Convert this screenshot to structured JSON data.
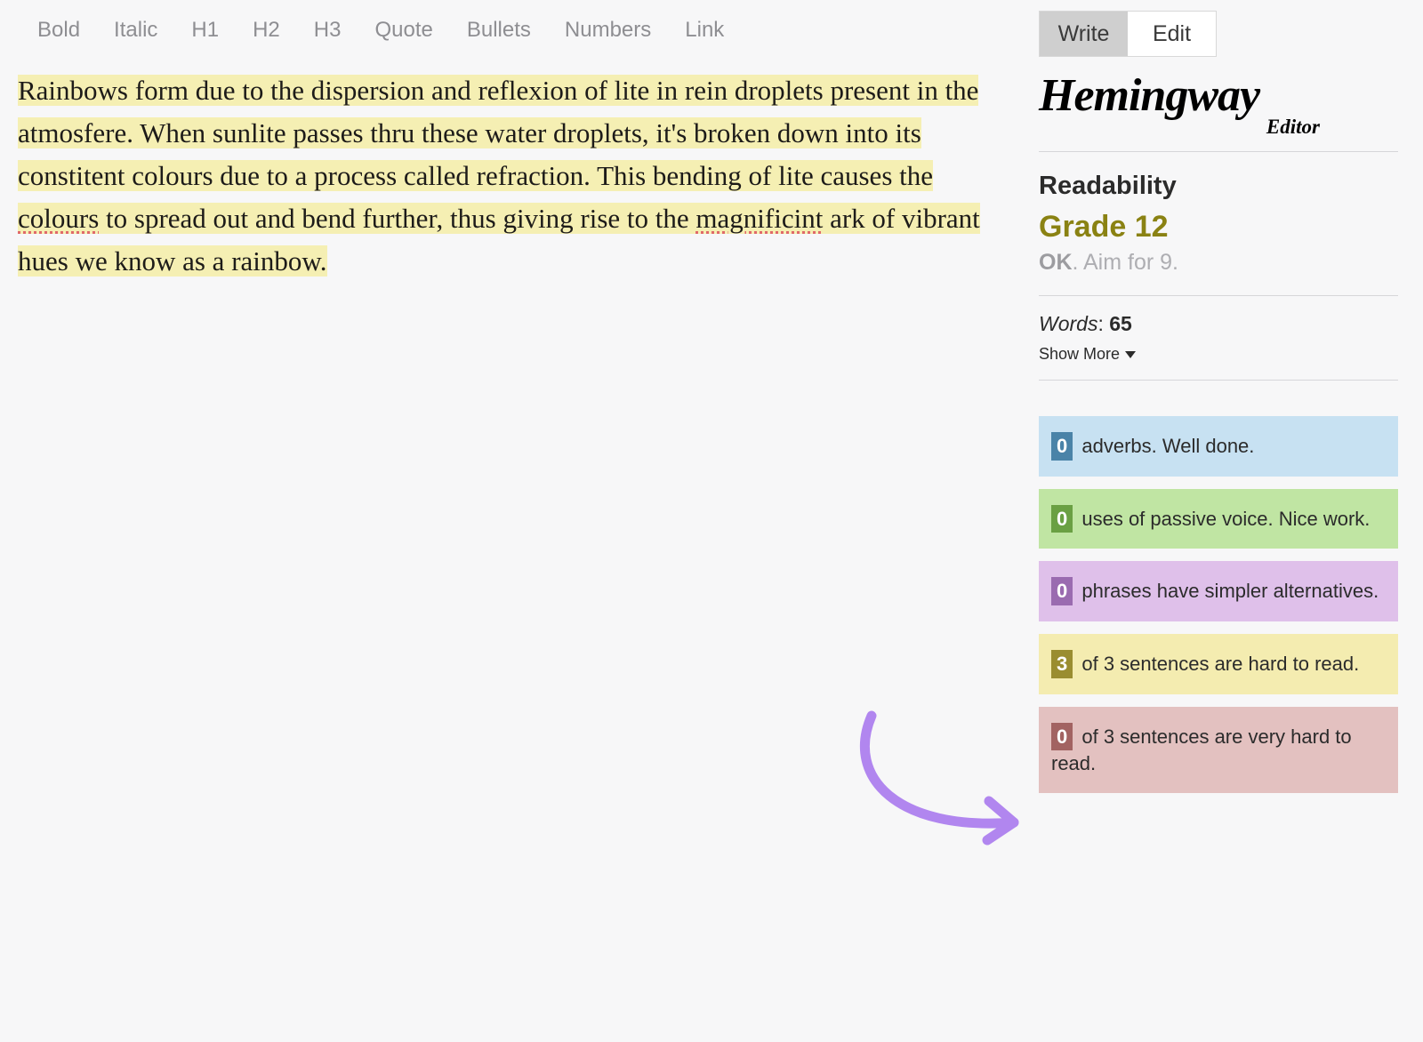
{
  "toolbar": {
    "bold": "Bold",
    "italic": "Italic",
    "h1": "H1",
    "h2": "H2",
    "h3": "H3",
    "quote": "Quote",
    "bullets": "Bullets",
    "numbers": "Numbers",
    "link": "Link"
  },
  "mode": {
    "write": "Write",
    "edit": "Edit"
  },
  "logo": {
    "main": "Hemingway",
    "sub": "Editor"
  },
  "readability": {
    "heading": "Readability",
    "grade": "Grade 12",
    "ok": "OK",
    "note": ". Aim for 9."
  },
  "words": {
    "label": "Words",
    "sep": ": ",
    "count": "65"
  },
  "showmore": "Show More",
  "editor": {
    "s1": "Rainbows form due to the dispersion and reflexion of lite in rein droplets present in the atmosfere.",
    "s2a": " When sunlite passes thru these water droplets, it's broken down into its constitent colours due to a process called refraction.",
    "s3a": " This bending of lite causes the ",
    "s3_sp1": "colours",
    "s3b": " to spread out and bend further, thus giving rise to the ",
    "s3_sp2": "magnificint",
    "s3c": " ark of vibrant hues we know as a rainbow."
  },
  "stats": {
    "adverbs": {
      "count": "0",
      "text": " adverbs. Well done."
    },
    "passive": {
      "count": "0",
      "text": " uses of passive voice. Nice work."
    },
    "simpler": {
      "count": "0",
      "text": " phrases have simpler alternatives."
    },
    "hard": {
      "count": "3",
      "text": " of 3 sentences are hard to read."
    },
    "veryhard": {
      "count": "0",
      "text": " of 3 sentences are very hard to read."
    }
  }
}
